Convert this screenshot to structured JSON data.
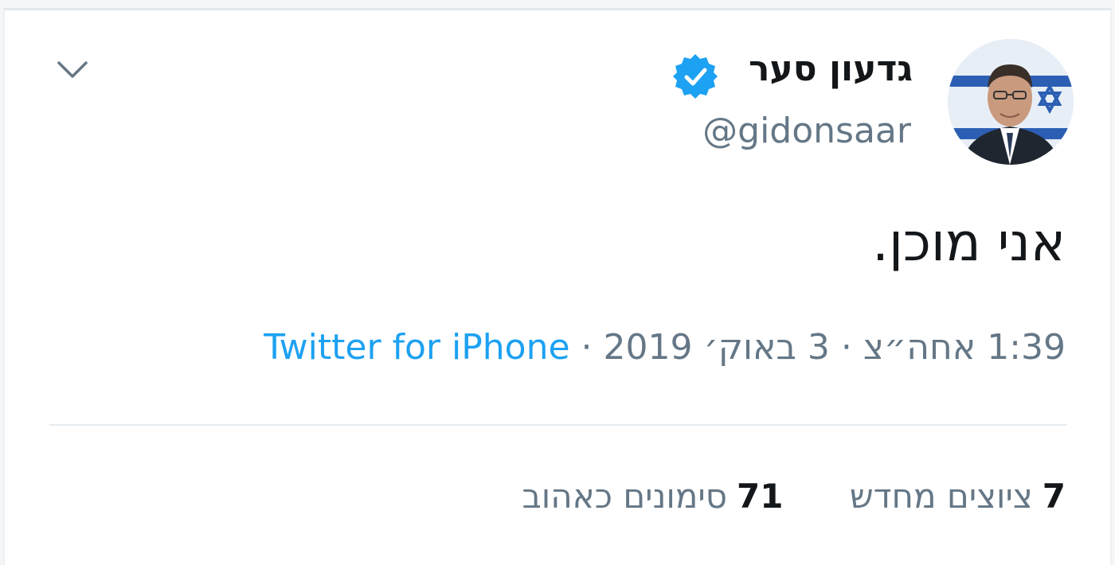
{
  "tweet": {
    "author": {
      "display_name": "גדעון סער",
      "handle": "@gidonsaar",
      "verified": true,
      "avatar": "profile-photo"
    },
    "text": "אני מוכן.",
    "time": "1:39 אחה״צ",
    "date": "3 באוק׳ 2019",
    "separator": "·",
    "source": "Twitter for iPhone",
    "stats": {
      "retweets_count": "7",
      "retweets_label": "ציוצים מחדש",
      "likes_count": "71",
      "likes_label": "סימונים כאהוב"
    },
    "menu_icon": "chevron-down-icon"
  },
  "colors": {
    "link": "#1da1f2",
    "secondary_text": "#657786",
    "primary_text": "#14171a",
    "verified_badge": "#1da1f2"
  }
}
